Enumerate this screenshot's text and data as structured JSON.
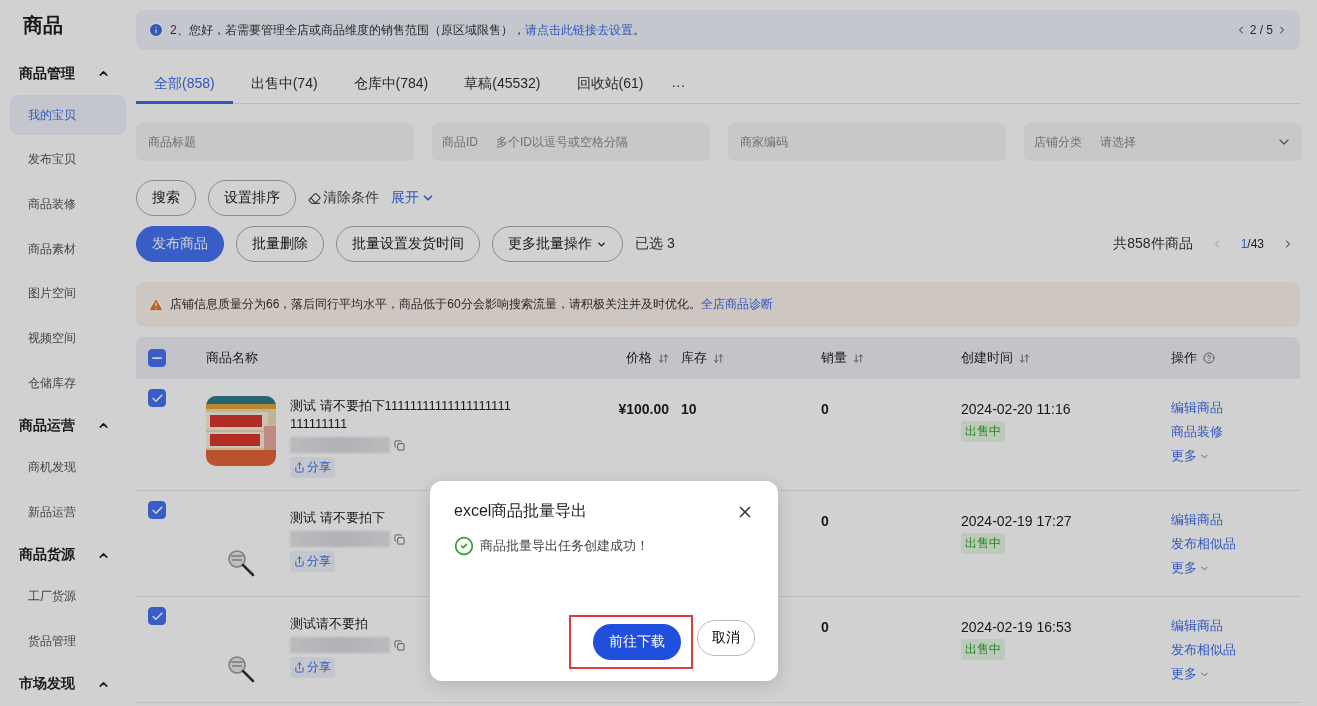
{
  "sidebar": {
    "title": "商品",
    "groups": [
      {
        "label": "商品管理",
        "expanded": true,
        "items": [
          {
            "label": "我的宝贝",
            "selected": true
          },
          {
            "label": "发布宝贝",
            "selected": false
          },
          {
            "label": "商品装修",
            "selected": false
          },
          {
            "label": "商品素材",
            "selected": false
          },
          {
            "label": "图片空间",
            "selected": false
          },
          {
            "label": "视频空间",
            "selected": false
          },
          {
            "label": "仓储库存",
            "selected": false
          }
        ]
      },
      {
        "label": "商品运营",
        "expanded": true,
        "items": [
          {
            "label": "商机发现",
            "selected": false
          },
          {
            "label": "新品运营",
            "selected": false
          }
        ]
      },
      {
        "label": "商品货源",
        "expanded": true,
        "items": [
          {
            "label": "工厂货源",
            "selected": false
          },
          {
            "label": "货品管理",
            "selected": false
          }
        ]
      },
      {
        "label": "市场发现",
        "expanded": true
      }
    ]
  },
  "notice": {
    "text": "2、您好，若需要管理全店或商品维度的销售范围（原区域限售），",
    "link": "请点击此链接去设置",
    "tail": "。",
    "pager": "2 / 5"
  },
  "tabs": [
    {
      "label": "全部(858)",
      "selected": true
    },
    {
      "label": "出售中(74)",
      "selected": false
    },
    {
      "label": "仓库中(784)",
      "selected": false
    },
    {
      "label": "草稿(45532)",
      "selected": false
    },
    {
      "label": "回收站(61)",
      "selected": false
    }
  ],
  "tabs_more": "···",
  "filters": [
    {
      "kind": "text",
      "placeholder": "商品标题"
    },
    {
      "kind": "labeled",
      "label": "商品ID",
      "placeholder": "多个ID以逗号或空格分隔"
    },
    {
      "kind": "text",
      "placeholder": "商家编码"
    },
    {
      "kind": "select",
      "label": "店铺分类",
      "placeholder": "请选择"
    }
  ],
  "search_buttons": [
    "搜索",
    "设置排序"
  ],
  "clear": "清除条件",
  "expand": "展开",
  "actions": {
    "primary": "发布商品",
    "buttons": [
      "批量删除",
      "批量设置发货时间"
    ],
    "more": "更多批量操作",
    "selected": "已选 3",
    "total": "共858件商品",
    "page": "1",
    "pages": "/43"
  },
  "warning": {
    "text": "店铺信息质量分为66，落后同行平均水平，商品低于60分会影响搜索流量，请积极关注并及时优化。",
    "link": "全店商品诊断"
  },
  "table": {
    "select_all": {
      "checked": true,
      "indeterminate": true
    },
    "columns": [
      {
        "label": "商品名称",
        "sortable": false
      },
      {
        "label": "价格",
        "sortable": true
      },
      {
        "label": "库存",
        "sortable": true
      },
      {
        "label": "销量",
        "sortable": true
      },
      {
        "label": "创建时间",
        "sortable": true
      },
      {
        "label": "操作",
        "sortable": false,
        "help": true
      }
    ],
    "rows": [
      {
        "checked": true,
        "kind": "picture",
        "title": "测试 请不要拍下11111111111111111111 111111111",
        "share": "分享",
        "price": "¥100.00",
        "stock": "10",
        "sales": "0",
        "created": "2024-02-20 11:16",
        "status": "出售中",
        "ops": [
          "编辑商品",
          "商品装修"
        ],
        "more": "更多"
      },
      {
        "checked": true,
        "kind": "placeholder",
        "title": "测试 请不要拍下",
        "share": "分享",
        "sales": "0",
        "created": "2024-02-19 17:27",
        "status": "出售中",
        "ops": [
          "编辑商品",
          "发布相似品"
        ],
        "more": "更多"
      },
      {
        "checked": true,
        "kind": "placeholder",
        "title": "测试请不要拍",
        "share": "分享",
        "sales": "0",
        "created": "2024-02-19 16:53",
        "status": "出售中",
        "ops": [
          "编辑商品",
          "发布相似品"
        ],
        "more": "更多"
      }
    ]
  },
  "dialog": {
    "title": "excel商品批量导出",
    "message": "商品批量导出任务创建成功！",
    "primary": "前往下载",
    "cancel": "取消",
    "primary_highlighted": true
  }
}
